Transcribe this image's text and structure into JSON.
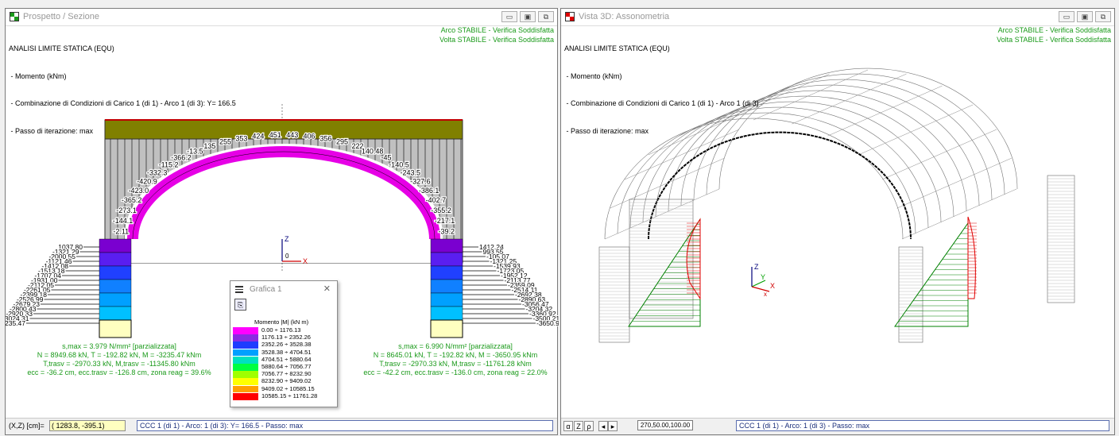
{
  "left_window": {
    "title": "Prospetto / Sezione",
    "info_lines": [
      "ANALISI LIMITE STATICA (EQU)",
      " - Momento (kNm)",
      " - Combinazione di Condizioni di Carico 1 (di 1) - Arco 1 (di 3): Y= 166.5",
      " - Passo di iterazione: max"
    ],
    "status_lines": [
      "Arco STABILE - Verifica Soddisfatta",
      "Volta STABILE - Verifica Soddisfatta"
    ],
    "axis_labels": {
      "z": "Z",
      "x": "X",
      "origin": "0"
    },
    "arch_labels": [
      "-2.11",
      "-144.1",
      "-273.1",
      "-365.2",
      "-423.0",
      "-420.9",
      "-332.3",
      "-115.2",
      "-366.2",
      "-13.5",
      "135",
      "255",
      "353",
      "424",
      "451",
      "443",
      "406",
      "356",
      "295",
      "222",
      "140.48",
      "-45",
      "-140.5",
      "-243.5",
      "-327.6",
      "-386.1",
      "-402.7",
      "-355.2",
      "-217.1",
      "-39.2"
    ],
    "left_support_labels": [
      "1037.80",
      "-1321.29",
      "-2000.55",
      "-1121.46",
      "-1412.08",
      "-1513.18",
      "-1707.04",
      "-1931.00",
      "-2112.05",
      "-2261.05",
      "-2399.18",
      "-2526.99",
      "-2679.23",
      "-2800.43",
      "-2920.33",
      "-3024.31",
      "-3235.47"
    ],
    "right_support_labels": [
      "1412.24",
      "993.55",
      "-105.07",
      "-1321.25",
      "-1539.93",
      "-1723.05",
      "-1952.12",
      "-2113.77",
      "-2359.09",
      "-2514.11",
      "-2692.38",
      "-2890.63",
      "-3056.47",
      "-3204.32",
      "-3360.92",
      "-3500.21",
      "-3650.95"
    ],
    "left_results": [
      "s,max = 3.979 N/mm² [parzializzata]",
      "N = 8949.68 kN, T = -192.82 kN, M = -3235.47 kNm",
      "T,trasv = -2970.33 kN, M,trasv = -11345.80 kNm",
      "ecc = -36.2 cm, ecc.trasv = -126.8 cm, zona reag = 39.6%"
    ],
    "right_results": [
      "s,max = 6.990 N/mm² [parzializzata]",
      "N = 8645.01 kN, T = -192.82 kN, M = -3650.95 kNm",
      "T,trasv = -2970.33 kN, M,trasv = -11761.28 kNm",
      "ecc = -42.2 cm, ecc.trasv = -136.0 cm, zona reag = 22.0%"
    ],
    "coord_label": "(X,Z) [cm]=",
    "coord_value": "( 1283.8, -395.1)",
    "ccc_text": "CCC 1 (di 1) - Arco: 1 (di 3): Y= 166.5 - Passo: max"
  },
  "right_window": {
    "title": "Vista 3D: Assonometria",
    "info_lines": [
      "ANALISI LIMITE STATICA (EQU)",
      " - Momento (kNm)",
      " - Combinazione di Condizioni di Carico 1 (di 1) - Arco 1 (di 3)",
      " - Passo di iterazione: max"
    ],
    "status_lines": [
      "Arco STABILE - Verifica Soddisfatta",
      "Volta STABILE - Verifica Soddisfatta"
    ],
    "axis_labels": {
      "z": "Z",
      "y": "Y",
      "x": "X",
      "x2": "x"
    },
    "toolbar": {
      "alpha": "α",
      "z": "Z",
      "rho": "ρ",
      "prev": "◂",
      "next": "▸"
    },
    "view_params": "270,50.00,100.00",
    "ccc_text": "CCC 1 (di 1) - Arco: 1 (di 3) - Passo: max"
  },
  "legend": {
    "title": "Grafica 1",
    "close": "✕",
    "heading": "Momento |M| (kN m)",
    "ranges": [
      {
        "label": "0.00 ÷ 1176.13",
        "color": "#ff00ff"
      },
      {
        "label": "1176.13 ÷ 2352.26",
        "color": "#8a2be2"
      },
      {
        "label": "2352.26 ÷ 3528.38",
        "color": "#1e3cff"
      },
      {
        "label": "3528.38 ÷ 4704.51",
        "color": "#00a0ff"
      },
      {
        "label": "4704.51 ÷ 5880.64",
        "color": "#00e0c0"
      },
      {
        "label": "5880.64 ÷ 7056.77",
        "color": "#00ff40"
      },
      {
        "label": "7056.77 ÷ 8232.90",
        "color": "#a0ff00"
      },
      {
        "label": "8232.90 ÷ 9409.02",
        "color": "#ffff00"
      },
      {
        "label": "9409.02 ÷ 10585.15",
        "color": "#ffa000"
      },
      {
        "label": "10585.15 ÷ 11761.28",
        "color": "#ff0000"
      }
    ]
  },
  "colors": {
    "status_green": "#1a9a1a",
    "wall_gray": "#c0c0c0",
    "crown_olive": "#808000",
    "diagram_green": "#008000",
    "diagram_red": "#e00000"
  }
}
